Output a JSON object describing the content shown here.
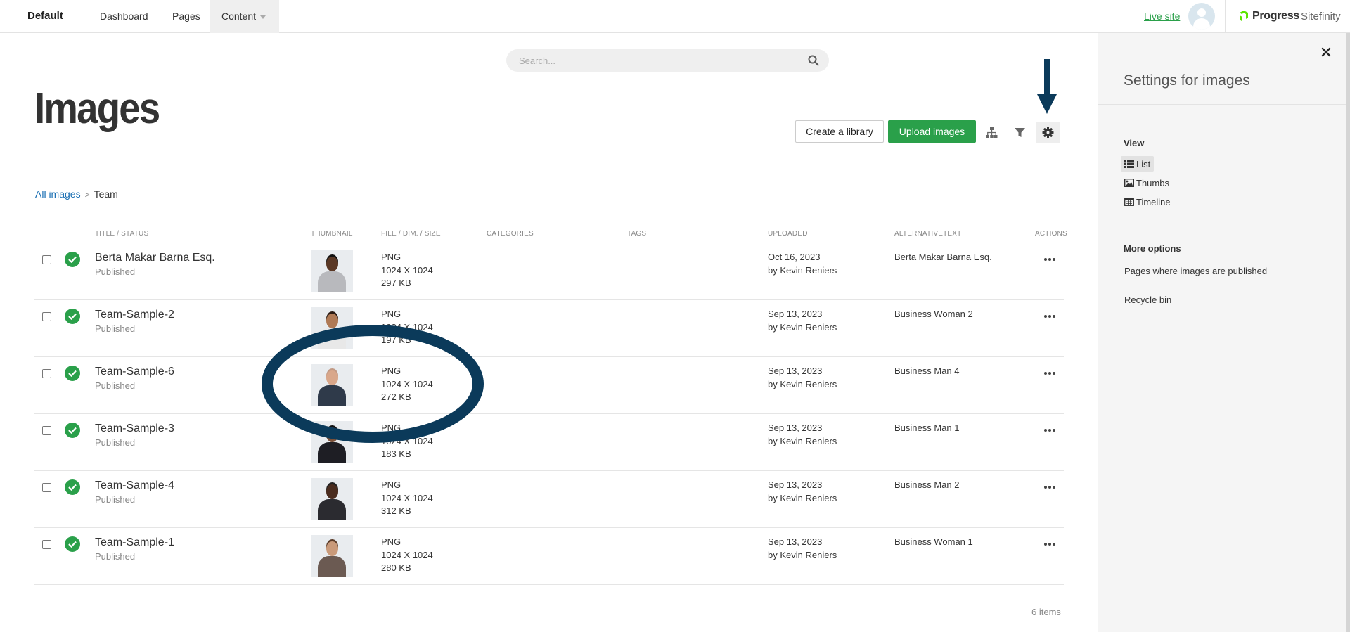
{
  "topbar": {
    "site_name": "Default",
    "nav": {
      "dashboard": "Dashboard",
      "pages": "Pages",
      "content": "Content"
    },
    "live_site": "Live site",
    "brand_progress": "Progress",
    "brand_sitefinity": "Sitefinity"
  },
  "search": {
    "placeholder": "Search..."
  },
  "page_title": "Images",
  "toolbar": {
    "create_library": "Create a library",
    "upload_images": "Upload images"
  },
  "breadcrumb": {
    "root": "All images",
    "current": "Team"
  },
  "table": {
    "headers": {
      "title_status": "TITLE / STATUS",
      "thumbnail": "THUMBNAIL",
      "file": "FILE / DIM. / SIZE",
      "categories": "CATEGORIES",
      "tags": "TAGS",
      "uploaded": "UPLOADED",
      "alt": "ALTERNATIVETEXT",
      "actions": "ACTIONS"
    },
    "rows": [
      {
        "title": "Berta Makar Barna Esq.",
        "status": "Published",
        "type": "PNG",
        "dim": "1024 X 1024",
        "size": "297 KB",
        "date": "Oct 16, 2023",
        "by": "by Kevin Reniers",
        "alt": "Berta Makar Barna Esq."
      },
      {
        "title": "Team-Sample-2",
        "status": "Published",
        "type": "PNG",
        "dim": "1024 X 1024",
        "size": "197 KB",
        "date": "Sep 13, 2023",
        "by": "by Kevin Reniers",
        "alt": "Business Woman 2"
      },
      {
        "title": "Team-Sample-6",
        "status": "Published",
        "type": "PNG",
        "dim": "1024 X 1024",
        "size": "272 KB",
        "date": "Sep 13, 2023",
        "by": "by Kevin Reniers",
        "alt": "Business Man 4"
      },
      {
        "title": "Team-Sample-3",
        "status": "Published",
        "type": "PNG",
        "dim": "1024 X 1024",
        "size": "183 KB",
        "date": "Sep 13, 2023",
        "by": "by Kevin Reniers",
        "alt": "Business Man 1"
      },
      {
        "title": "Team-Sample-4",
        "status": "Published",
        "type": "PNG",
        "dim": "1024 X 1024",
        "size": "312 KB",
        "date": "Sep 13, 2023",
        "by": "by Kevin Reniers",
        "alt": "Business Man 2"
      },
      {
        "title": "Team-Sample-1",
        "status": "Published",
        "type": "PNG",
        "dim": "1024 X 1024",
        "size": "280 KB",
        "date": "Sep 13, 2023",
        "by": "by Kevin Reniers",
        "alt": "Business Woman 1"
      }
    ],
    "items_count": "6 items"
  },
  "panel": {
    "title": "Settings for images",
    "view_label": "View",
    "view_options": {
      "list": "List",
      "thumbs": "Thumbs",
      "timeline": "Timeline"
    },
    "more_options_label": "More options",
    "more_options": {
      "pages_published": "Pages where images are published",
      "recycle_bin": "Recycle bin"
    }
  },
  "colors": {
    "accent_green": "#2aa04a",
    "link_blue": "#1a6fb3",
    "annotation_navy": "#0b3a5a"
  },
  "icons": [
    "search-icon",
    "sitemap-icon",
    "filter-icon",
    "gear-icon",
    "check-icon",
    "more-icon",
    "close-icon",
    "list-icon",
    "image-icon",
    "calendar-icon"
  ]
}
